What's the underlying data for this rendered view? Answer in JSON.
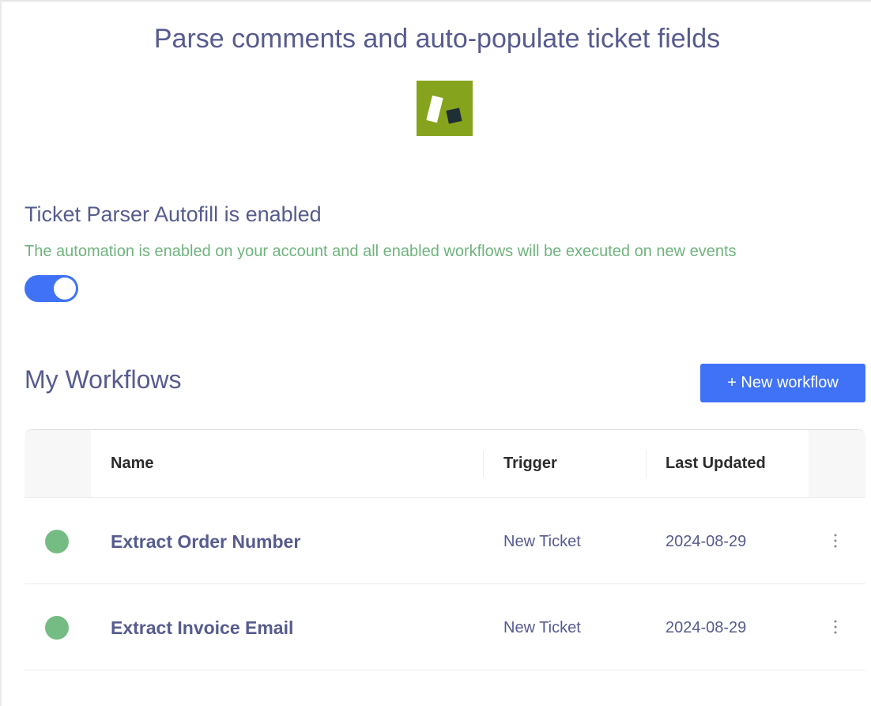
{
  "page": {
    "title": "Parse comments and auto-populate ticket fields"
  },
  "status": {
    "heading": "Ticket Parser Autofill is enabled",
    "description": "The automation is enabled on your account and all enabled workflows will be executed on new events",
    "enabled": true
  },
  "workflows": {
    "title": "My Workflows",
    "new_button_label": "+ New workflow",
    "columns": {
      "name": "Name",
      "trigger": "Trigger",
      "last_updated": "Last Updated"
    },
    "rows": [
      {
        "name": "Extract Order Number",
        "trigger": "New Ticket",
        "last_updated": "2024-08-29",
        "status": "enabled"
      },
      {
        "name": "Extract Invoice Email",
        "trigger": "New Ticket",
        "last_updated": "2024-08-29",
        "status": "enabled"
      }
    ]
  },
  "icons": {
    "logo": "app-logo-icon",
    "row_status": "status-dot-icon",
    "row_menu": "kebab-menu-icon"
  },
  "colors": {
    "accent": "#3f72f6",
    "heading": "#565b8f",
    "success_text": "#6fb37d",
    "status_dot": "#75bb84",
    "logo_bg": "#86a31d"
  }
}
